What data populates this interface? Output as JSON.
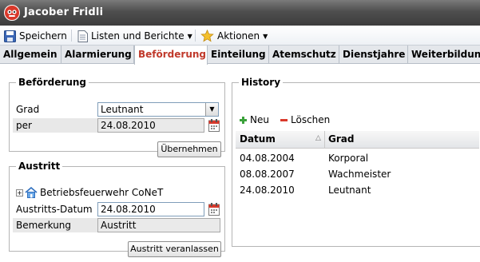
{
  "window": {
    "title": "Jacober Fridli"
  },
  "toolbar": {
    "save_label": "Speichern",
    "lists_label": "Listen und Berichte",
    "actions_label": "Aktionen"
  },
  "tabs": [
    {
      "label": "Allgemein"
    },
    {
      "label": "Alarmierung"
    },
    {
      "label": "Beförderung"
    },
    {
      "label": "Einteilung"
    },
    {
      "label": "Atemschutz"
    },
    {
      "label": "Dienstjahre"
    },
    {
      "label": "Weiterbildung"
    }
  ],
  "promotion": {
    "legend": "Beförderung",
    "grade_label": "Grad",
    "grade_value": "Leutnant",
    "date_label": "per",
    "date_value": "24.08.2010",
    "apply_label": "Übernehmen"
  },
  "exit": {
    "legend": "Austritt",
    "org_label": "Betriebsfeuerwehr CoNeT",
    "date_label": "Austritts-Datum",
    "date_value": "24.08.2010",
    "remark_label": "Bemerkung",
    "remark_value": "Austritt",
    "submit_label": "Austritt veranlassen"
  },
  "history": {
    "legend": "History",
    "new_label": "Neu",
    "delete_label": "Löschen",
    "columns": [
      "Datum",
      "Grad"
    ],
    "rows": [
      {
        "date": "04.08.2004",
        "grade": "Korporal"
      },
      {
        "date": "08.08.2007",
        "grade": "Wachmeister"
      },
      {
        "date": "24.08.2010",
        "grade": "Leutnant"
      }
    ]
  },
  "colors": {
    "active_tab": "#c0392b",
    "titlebar": "#4e4e4e"
  }
}
